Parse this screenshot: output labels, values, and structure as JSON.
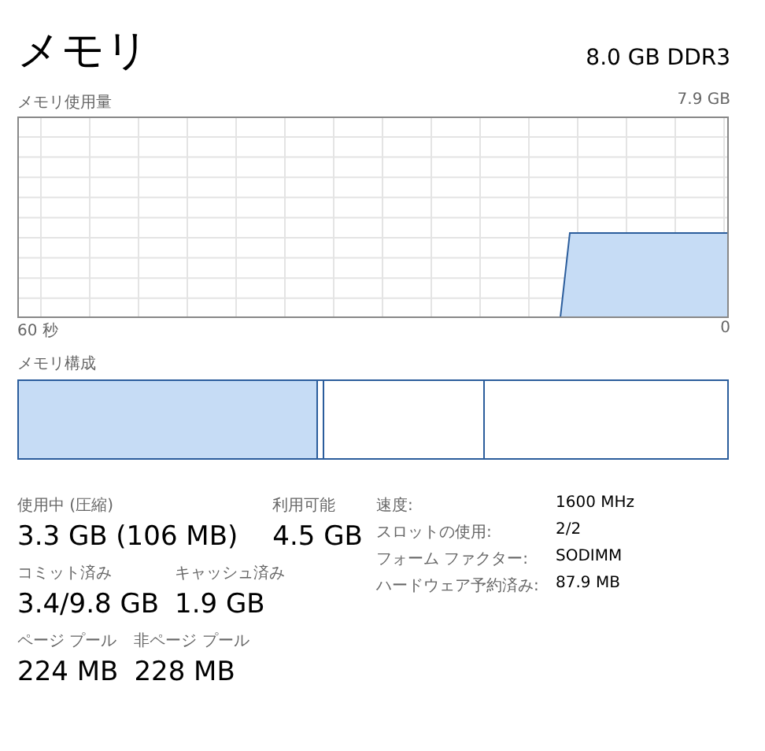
{
  "header": {
    "title": "メモリ",
    "capacity": "8.0 GB DDR3"
  },
  "usage_graph": {
    "label": "メモリ使用量",
    "max": "7.9 GB",
    "time_start": "60 秒",
    "time_end": "0"
  },
  "composition": {
    "label": "メモリ構成"
  },
  "stats": [
    [
      {
        "label": "使用中 (圧縮)",
        "value": "3.3 GB (106 MB)"
      },
      {
        "label": "利用可能",
        "value": "4.5 GB"
      }
    ],
    [
      {
        "label": "コミット済み",
        "value": "3.4/9.8 GB"
      },
      {
        "label": "キャッシュ済み",
        "value": "1.9 GB"
      }
    ],
    [
      {
        "label": "ページ プール",
        "value": "224 MB"
      },
      {
        "label": "非ページ プール",
        "value": "228 MB"
      }
    ]
  ],
  "properties": [
    {
      "name": "速度:",
      "value": "1600 MHz"
    },
    {
      "name": "スロットの使用:",
      "value": "2/2"
    },
    {
      "name": "フォーム ファクター:",
      "value": "SODIMM"
    },
    {
      "name": "ハードウェア予約済み:",
      "value": "87.9 MB"
    }
  ]
}
